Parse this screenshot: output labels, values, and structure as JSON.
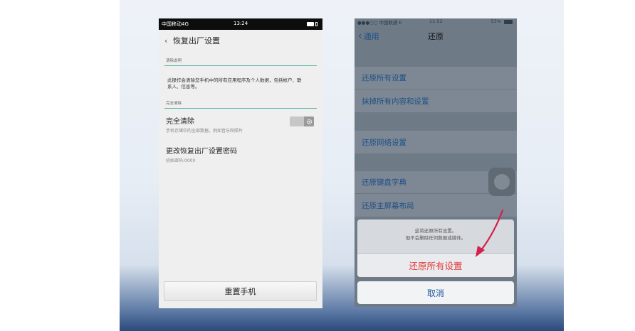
{
  "android": {
    "status": {
      "carrier": "中国移动4G",
      "time": "13:24"
    },
    "title": "恢复出厂设置",
    "back_glyph": "‹",
    "section1_header": "清除说明",
    "description": "此操作会清除您手机中的所有应用程序及个人数据，包括帐户、联系人、信息等。",
    "section2_header": "完全清除",
    "full_wipe": {
      "title": "完全清除",
      "subtitle": "手机存储中的全部数据，例如音乐和照片"
    },
    "change_password": {
      "title": "更改恢复出厂设置密码",
      "subtitle": "初始密码:0000"
    },
    "reset_button": "重置手机"
  },
  "ios": {
    "status": {
      "carrier": "●●●○○ 中国联通  E",
      "time": "11:52",
      "battery": "53%"
    },
    "back_label": "通用",
    "title": "还原",
    "cells": {
      "reset_all_settings": "还原所有设置",
      "erase_all": "抹掉所有内容和设置",
      "reset_network": "还原网络设置",
      "reset_keyboard": "还原键盘字典",
      "reset_home_layout": "还原主屏幕布局"
    },
    "sheet": {
      "message_line1": "这将还原所有设置。",
      "message_line2": "但不会删除任何数据或媒体。",
      "confirm": "还原所有设置",
      "cancel": "取消"
    }
  },
  "colors": {
    "android_accent_line": "#58b3a6",
    "ios_link_blue": "#1f4f86",
    "destructive_red": "#e23a3a",
    "annotation_arrow": "#d4204a"
  },
  "icons": [
    "signal-icon",
    "battery-icon",
    "gear-icon",
    "back-chevron-icon",
    "arrow-annotation"
  ]
}
